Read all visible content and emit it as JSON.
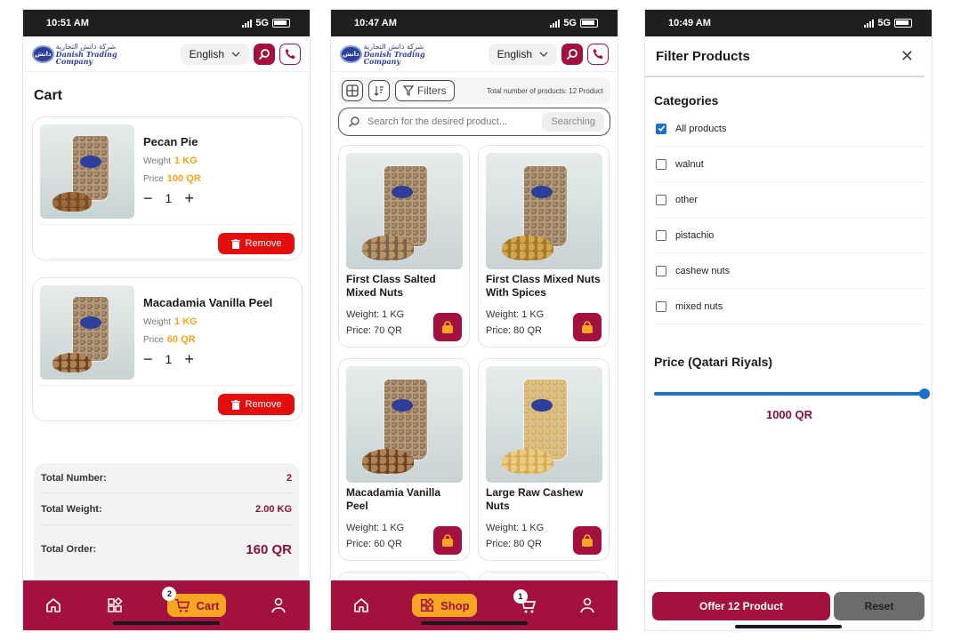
{
  "common": {
    "language": "English",
    "logo_ar": "شركة دانش التجارية",
    "logo_en": "Danish Trading Company",
    "colors": {
      "brand": "#a3123f",
      "accent": "#f6a623",
      "price": "#f3a51b",
      "danger": "#e30e0e",
      "link": "#1a73c8"
    },
    "icons": [
      "search-icon",
      "phone-icon",
      "chevron-down-icon",
      "home-icon",
      "shop-icon",
      "cart-icon",
      "user-icon",
      "trash-icon",
      "bag-icon",
      "grid-view-icon",
      "sort-icon",
      "filter-icon",
      "close-icon",
      "check-icon"
    ]
  },
  "cart_screen": {
    "status_time": "10:51 AM",
    "network": "5G",
    "title": "Cart",
    "items": [
      {
        "name": "Pecan Pie",
        "weight_label": "Weight",
        "weight": "1 KG",
        "price_label": "Price",
        "price": "100 QR",
        "qty": "1",
        "remove_label": "Remove"
      },
      {
        "name": "Macadamia Vanilla Peel",
        "weight_label": "Weight",
        "weight": "1 KG",
        "price_label": "Price",
        "price": "60 QR",
        "qty": "1",
        "remove_label": "Remove"
      }
    ],
    "summary": {
      "total_number_label": "Total Number:",
      "total_number": "2",
      "total_weight_label": "Total Weight:",
      "total_weight": "2.00 KG",
      "total_order_label": "Total Order:",
      "total_order": "160 QR"
    },
    "nav": {
      "cart_label": "Cart",
      "cart_badge": "2"
    }
  },
  "shop_screen": {
    "status_time": "10:47 AM",
    "network": "5G",
    "filters_label": "Filters",
    "total_products": "Total number of products: 12 Product",
    "search_placeholder": "Search for the desired product...",
    "searching_label": "Searching",
    "products": [
      {
        "name": "First Class Salted Mixed Nuts",
        "weight": "Weight: 1 KG",
        "price": "Price: 70 QR"
      },
      {
        "name": "First Class Mixed Nuts With Spices",
        "weight": "Weight: 1 KG",
        "price": "Price: 80 QR"
      },
      {
        "name": "Macadamia Vanilla Peel",
        "weight": "Weight: 1 KG",
        "price": "Price: 60 QR"
      },
      {
        "name": "Large Raw Cashew Nuts",
        "weight": "Weight: 1 KG",
        "price": "Price: 80 QR"
      }
    ],
    "nav": {
      "shop_label": "Shop",
      "cart_badge": "1"
    }
  },
  "filter_screen": {
    "status_time": "10:49 AM",
    "network": "5G",
    "title": "Filter Products",
    "categories_title": "Categories",
    "categories": [
      {
        "label": "All products",
        "checked": true
      },
      {
        "label": "walnut",
        "checked": false
      },
      {
        "label": "other",
        "checked": false
      },
      {
        "label": "pistachio",
        "checked": false
      },
      {
        "label": "cashew nuts",
        "checked": false
      },
      {
        "label": "mixed nuts",
        "checked": false
      }
    ],
    "price_title": "Price (Qatari Riyals)",
    "price_value": "1000 QR",
    "slider_fraction": 1.0,
    "offer_label": "Offer 12 Product",
    "reset_label": "Reset"
  }
}
